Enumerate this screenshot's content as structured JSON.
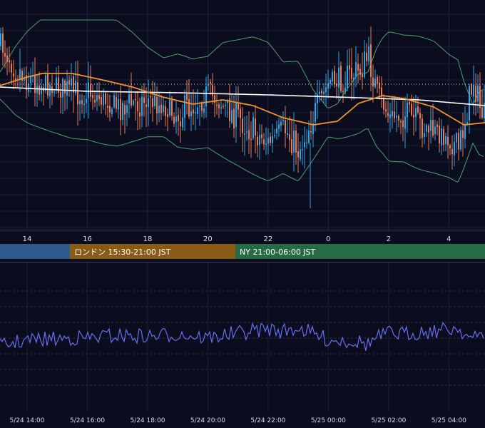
{
  "chart_data": [
    {
      "type": "candlestick",
      "x_ticks": [
        "14",
        "16",
        "18",
        "20",
        "22",
        "0",
        "2",
        "4"
      ],
      "x_range_hours": [
        13.1,
        29.2
      ],
      "overlays": [
        {
          "kind": "bollinger-bands",
          "color": "#5fb77a"
        },
        {
          "kind": "moving-average-short",
          "color": "#f0922e"
        },
        {
          "kind": "moving-average-long",
          "color": "#ffffff"
        },
        {
          "kind": "reference-line",
          "color": "#cfd2dc",
          "style": "dotted"
        }
      ],
      "candle_colors": {
        "up": "#2fa3e6",
        "down": "#e97b57"
      },
      "price_path": [
        {
          "h": 13.1,
          "p": 62
        },
        {
          "h": 13.3,
          "p": 74
        },
        {
          "h": 13.6,
          "p": 95
        },
        {
          "h": 14.0,
          "p": 110
        },
        {
          "h": 14.5,
          "p": 118
        },
        {
          "h": 15.0,
          "p": 122
        },
        {
          "h": 15.5,
          "p": 130
        },
        {
          "h": 16.0,
          "p": 128
        },
        {
          "h": 16.5,
          "p": 140
        },
        {
          "h": 17.0,
          "p": 150
        },
        {
          "h": 17.5,
          "p": 145
        },
        {
          "h": 18.0,
          "p": 140
        },
        {
          "h": 18.5,
          "p": 150
        },
        {
          "h": 19.0,
          "p": 160
        },
        {
          "h": 19.5,
          "p": 145
        },
        {
          "h": 20.0,
          "p": 130
        },
        {
          "h": 20.5,
          "p": 150
        },
        {
          "h": 21.0,
          "p": 165
        },
        {
          "h": 21.5,
          "p": 185
        },
        {
          "h": 22.0,
          "p": 200
        },
        {
          "h": 22.5,
          "p": 180
        },
        {
          "h": 23.0,
          "p": 210
        },
        {
          "h": 23.5,
          "p": 160
        },
        {
          "h": 24.0,
          "p": 115
        },
        {
          "h": 24.5,
          "p": 110
        },
        {
          "h": 25.0,
          "p": 100
        },
        {
          "h": 25.3,
          "p": 80
        },
        {
          "h": 25.6,
          "p": 130
        },
        {
          "h": 26.0,
          "p": 165
        },
        {
          "h": 26.5,
          "p": 160
        },
        {
          "h": 27.0,
          "p": 175
        },
        {
          "h": 27.5,
          "p": 185
        },
        {
          "h": 28.0,
          "p": 195
        },
        {
          "h": 28.3,
          "p": 210
        },
        {
          "h": 28.6,
          "p": 150
        },
        {
          "h": 28.8,
          "p": 110
        },
        {
          "h": 29.0,
          "p": 150
        },
        {
          "h": 29.2,
          "p": 165
        }
      ],
      "ma_short": [
        {
          "h": 13.1,
          "v": 120
        },
        {
          "h": 14.0,
          "v": 108
        },
        {
          "h": 14.5,
          "v": 103
        },
        {
          "h": 15.5,
          "v": 103
        },
        {
          "h": 16.5,
          "v": 112
        },
        {
          "h": 17.5,
          "v": 122
        },
        {
          "h": 18.5,
          "v": 136
        },
        {
          "h": 19.5,
          "v": 146
        },
        {
          "h": 20.5,
          "v": 140
        },
        {
          "h": 21.5,
          "v": 148
        },
        {
          "h": 22.5,
          "v": 165
        },
        {
          "h": 23.5,
          "v": 175
        },
        {
          "h": 24.3,
          "v": 170
        },
        {
          "h": 25.0,
          "v": 145
        },
        {
          "h": 25.8,
          "v": 134
        },
        {
          "h": 26.5,
          "v": 138
        },
        {
          "h": 27.5,
          "v": 150
        },
        {
          "h": 28.5,
          "v": 175
        },
        {
          "h": 29.2,
          "v": 172
        }
      ],
      "ma_long": [
        {
          "h": 13.1,
          "v": 122
        },
        {
          "h": 16.0,
          "v": 128
        },
        {
          "h": 19.0,
          "v": 130
        },
        {
          "h": 22.0,
          "v": 133
        },
        {
          "h": 25.0,
          "v": 137
        },
        {
          "h": 27.0,
          "v": 140
        },
        {
          "h": 29.2,
          "v": 148
        }
      ],
      "reference_level": 118
    },
    {
      "type": "line",
      "series_color": "#6670ee",
      "x_ticks": [
        "5/24 14:00",
        "5/24 16:00",
        "5/24 18:00",
        "5/24 20:00",
        "5/24 22:00",
        "5/25 00:00",
        "5/25 02:00",
        "5/25 04:00"
      ]
    }
  ],
  "sessions": [
    {
      "label": "",
      "color": "#2e5a8c"
    },
    {
      "label": "ロンドン 15:30-21:00 JST",
      "color": "#8a5a17"
    },
    {
      "label": "NY 21:00-06:00 JST",
      "color": "#276b45"
    }
  ]
}
